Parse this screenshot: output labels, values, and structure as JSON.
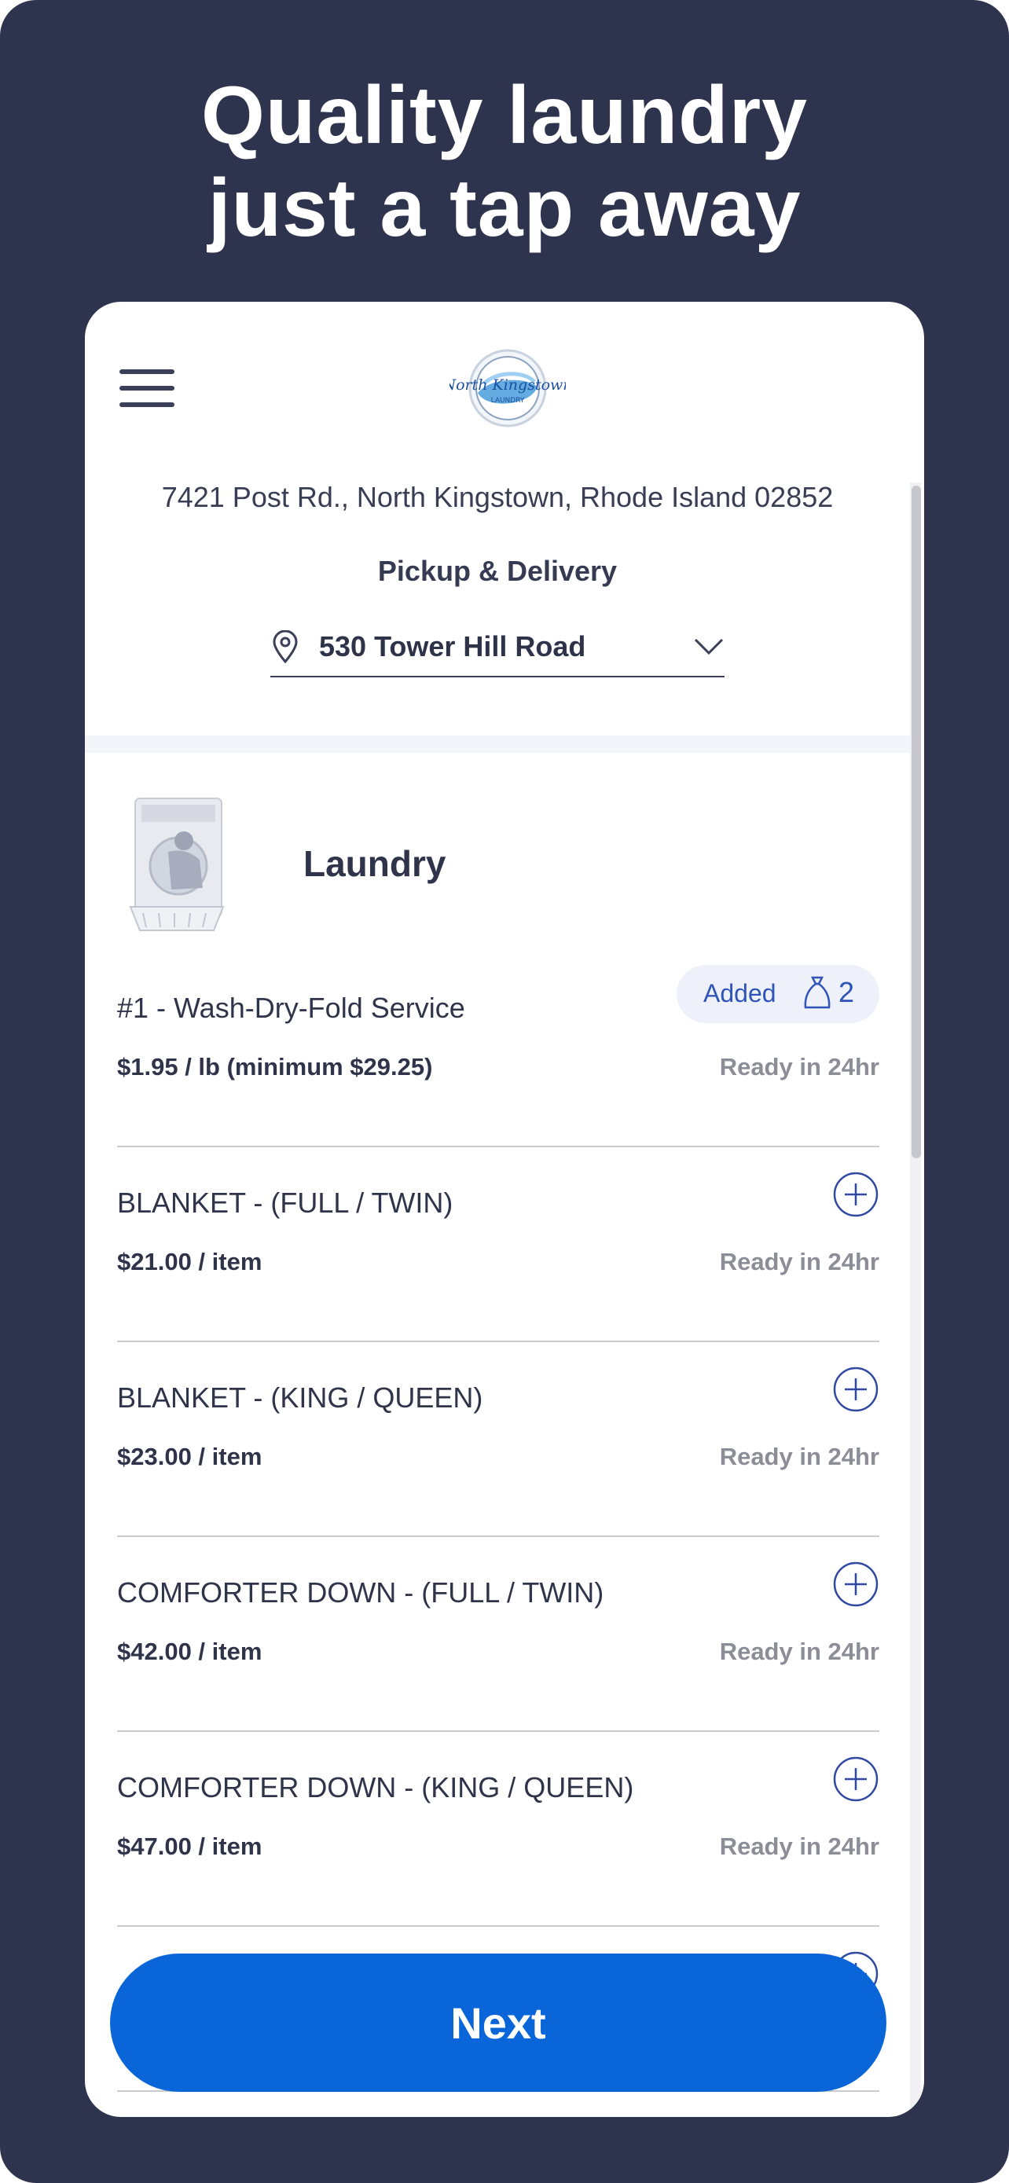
{
  "headline": {
    "line1": "Quality laundry",
    "line2": "just a tap away"
  },
  "header": {
    "menu_icon": "hamburger-menu-icon",
    "logo_name": "north-kingstown-laundry-logo"
  },
  "store": {
    "address": "7421 Post Rd., North Kingstown, Rhode Island 02852"
  },
  "order": {
    "mode": "Pickup & Delivery",
    "delivery_address": "530 Tower Hill Road",
    "address_icon": "location-pin-icon",
    "dropdown_icon": "chevron-down-icon"
  },
  "category": {
    "title": "Laundry",
    "image_icon": "laundry-machine-illustration"
  },
  "services": [
    {
      "name": "#1 - Wash-Dry-Fold Service",
      "price": "$1.95 / lb (minimum $29.25)",
      "eta": "Ready in 24hr",
      "added": true,
      "added_label": "Added",
      "count": "2"
    },
    {
      "name": "BLANKET - (FULL / TWIN)",
      "price": "$21.00 / item",
      "eta": "Ready in 24hr",
      "added": false
    },
    {
      "name": "BLANKET - (KING / QUEEN)",
      "price": "$23.00 / item",
      "eta": "Ready in 24hr",
      "added": false
    },
    {
      "name": "COMFORTER DOWN - (FULL / TWIN)",
      "price": "$42.00 / item",
      "eta": "Ready in 24hr",
      "added": false
    },
    {
      "name": "COMFORTER DOWN - (KING / QUEEN)",
      "price": "$47.00 / item",
      "eta": "Ready in 24hr",
      "added": false
    }
  ],
  "footer": {
    "next_label": "Next"
  },
  "colors": {
    "background": "#2f344e",
    "accent": "#0a66d8",
    "badge": "#eef1fa",
    "badge_text": "#2f55b6"
  }
}
